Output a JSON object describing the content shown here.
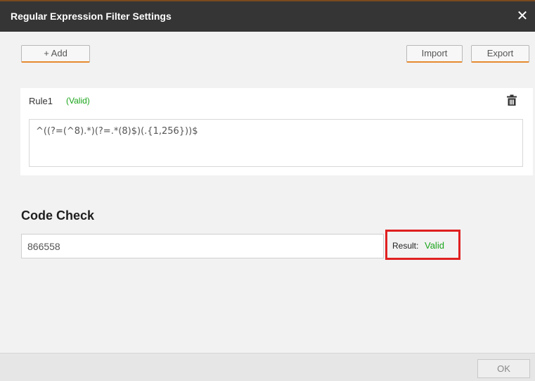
{
  "dialog": {
    "title": "Regular Expression Filter Settings",
    "close_glyph": "✕"
  },
  "toolbar": {
    "add_label": "+ Add",
    "import_label": "Import",
    "export_label": "Export"
  },
  "rules": [
    {
      "name": "Rule1",
      "status": "(Valid)",
      "expression": "^((?=(^8).*)(?=.*(8)$)(.{1,256}))$",
      "delete_icon": "trash-icon"
    }
  ],
  "code_check": {
    "title": "Code Check",
    "value": "866558",
    "result_label": "Result:",
    "result_value": "Valid"
  },
  "footer": {
    "ok_label": "OK"
  },
  "colors": {
    "titlebar": "#353535",
    "valid_green": "#1aa51a",
    "accent_orange": "#e58a2e",
    "highlight_red": "#e02020"
  }
}
